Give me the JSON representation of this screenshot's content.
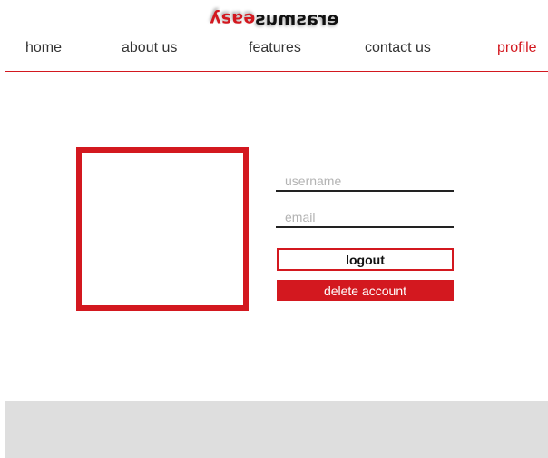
{
  "logo": {
    "part1": "easy",
    "part2": "erasmus"
  },
  "nav": {
    "items": [
      {
        "label": "home"
      },
      {
        "label": "about us"
      },
      {
        "label": "features"
      },
      {
        "label": "contact us"
      },
      {
        "label": "profile",
        "active": true
      }
    ]
  },
  "profile": {
    "username_placeholder": "username",
    "email_placeholder": "email",
    "logout_label": "logout",
    "delete_label": "delete account"
  },
  "colors": {
    "accent": "#d3181f",
    "text": "#333333",
    "footer": "#dedede"
  }
}
